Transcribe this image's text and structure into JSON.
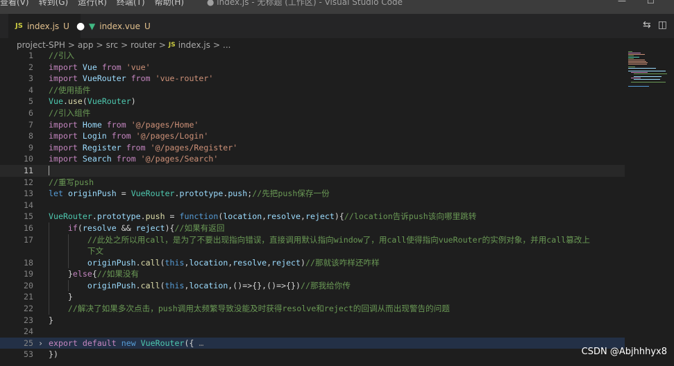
{
  "titlebar": {
    "menu": [
      "查看(V)",
      "转到(G)",
      "运行(R)",
      "终端(T)",
      "帮助(H)"
    ],
    "window_title": "● index.js - 无标题 (工作区) - Visual Studio Code",
    "minimize": "—",
    "maximize": "☐"
  },
  "tabs": [
    {
      "icon": "JS",
      "name": "index.js",
      "status": "U",
      "dirty": "●"
    },
    {
      "icon": "▼",
      "name": "index.vue",
      "status": "U"
    }
  ],
  "actions": {
    "compare": "⇆",
    "split": "◫"
  },
  "breadcrumb": [
    "project-SPH",
    "app",
    "src",
    "router",
    "index.js",
    "..."
  ],
  "breadcrumb_sep": ">",
  "breadcrumb_icon": "JS",
  "fold_icon": "›",
  "lines": [
    {
      "n": "1"
    },
    {
      "n": "2"
    },
    {
      "n": "3"
    },
    {
      "n": "4"
    },
    {
      "n": "5"
    },
    {
      "n": "6"
    },
    {
      "n": "7"
    },
    {
      "n": "8"
    },
    {
      "n": "9"
    },
    {
      "n": "10"
    },
    {
      "n": "11"
    },
    {
      "n": "12"
    },
    {
      "n": "13"
    },
    {
      "n": "14"
    },
    {
      "n": "15"
    },
    {
      "n": "16"
    },
    {
      "n": "17"
    },
    {
      "n": ""
    },
    {
      "n": "18"
    },
    {
      "n": "19"
    },
    {
      "n": "20"
    },
    {
      "n": "21"
    },
    {
      "n": "22"
    },
    {
      "n": "23"
    },
    {
      "n": "24"
    },
    {
      "n": "25"
    },
    {
      "n": "53"
    }
  ],
  "code": {
    "c1": "//引入",
    "import": "import",
    "from": "from",
    "vue": "Vue",
    "vue_str": "'vue'",
    "vue_router": "VueRouter",
    "vue_router_str": "'vue-router'",
    "c4": "//使用插件",
    "use": "use",
    "c6": "//引入组件",
    "home": "Home",
    "home_str": "'@/pages/Home'",
    "login": "Login",
    "login_str": "'@/pages/Login'",
    "register": "Register",
    "register_str": "'@/pages/Register'",
    "search": "Search",
    "search_str": "'@/pages/Search'",
    "c12": "//重写push",
    "let": "let",
    "originPush": "originPush",
    "prototype": "prototype",
    "push": "push",
    "c13": "//先把push保存一份",
    "function": "function",
    "location": "location",
    "resolve": "resolve",
    "reject": "reject",
    "c15": "//location告诉push该向哪里跳转",
    "if": "if",
    "c16": "//如果有返回",
    "c17a": "//此处之所以用call，是为了不要出现指向错误，直接调用默认指向window了，用call使得指向vueRouter的实例对象，并用call篡改上",
    "c17b": "下文",
    "call": "call",
    "this": "this",
    "c18": "//那就该咋样还咋样",
    "else": "else",
    "c19": "//如果没有",
    "c20": "//那我给你传",
    "c22": "//解决了如果多次点击，push调用太频繁导致没能及时获得resolve和reject的回调从而出现警告的问题",
    "export": "export",
    "default": "default",
    "new": "new",
    "ellipsis": "…"
  },
  "watermark": "CSDN @Abjhhhyx8"
}
